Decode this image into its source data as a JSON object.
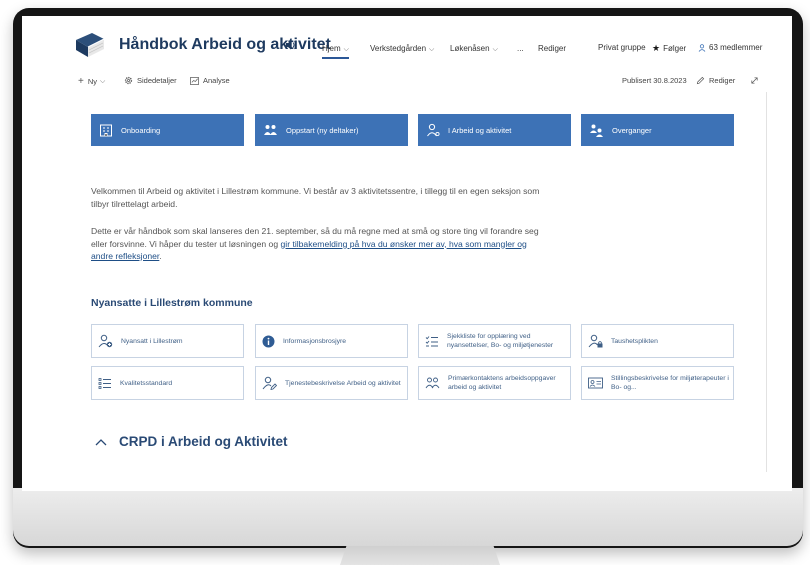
{
  "site": {
    "title": "Håndbok Arbeid og aktivitet"
  },
  "nav": {
    "items": [
      {
        "label": "Hjem",
        "dropdown": true
      },
      {
        "label": "Verkstedgården",
        "dropdown": true
      },
      {
        "label": "Løkenåsen",
        "dropdown": true
      },
      {
        "label": "..."
      },
      {
        "label": "Rediger"
      }
    ]
  },
  "header_right": {
    "group_type": "Privat gruppe",
    "follow": "Følger",
    "members": "63 medlemmer"
  },
  "commandbar": {
    "new": "Ny",
    "page_details": "Sidedetaljer",
    "analytics": "Analyse",
    "published": "Publisert 30.8.2023",
    "edit": "Rediger"
  },
  "quicklinks": [
    {
      "label": "Onboarding",
      "icon": "building-icon"
    },
    {
      "label": "Oppstart (ny deltaker)",
      "icon": "people-icon"
    },
    {
      "label": "I Arbeid og aktivitet",
      "icon": "person-icon"
    },
    {
      "label": "Overganger",
      "icon": "people-swap-icon"
    }
  ],
  "intro": {
    "p1": "Velkommen til Arbeid og aktivitet i Lillestrøm kommune. Vi består av 3 aktivitetssentre, i tillegg til en egen seksjon som tilbyr tilrettelagt arbeid.",
    "p2_start": "Dette er vår håndbok som skal lanseres den 21. september, så du må regne med at små og store ting vil forandre seg eller forsvinne. Vi håper du tester ut løsningen og ",
    "p2_link": "gir tilbakemelding på hva du ønsker mer av, hva som mangler og andre refleksjoner",
    "p2_end": "."
  },
  "section": {
    "title": "Nyansatte i Lillestrøm kommune"
  },
  "tiles": [
    {
      "label": "Nyansatt i Lillestrøm",
      "icon": "person-add-icon"
    },
    {
      "label": "Informasjonsbrosjyre",
      "icon": "info-icon"
    },
    {
      "label": "Sjekkliste for opplæring ved nyansettelser, Bo- og miljøtjenester",
      "icon": "checklist-icon"
    },
    {
      "label": "Taushetsplikten",
      "icon": "person-lock-icon"
    },
    {
      "label": "Kvalitetsstandard",
      "icon": "list-icon"
    },
    {
      "label": "Tjenestebeskrivelse Arbeid og aktivitet",
      "icon": "person-edit-icon"
    },
    {
      "label": "Primærkontaktens arbeidsoppgaver arbeid og aktivitet",
      "icon": "people-icon"
    },
    {
      "label": "Stillingsbeskrivelse for miljøterapeuter i Bo- og...",
      "icon": "contact-card-icon"
    }
  ],
  "crpd": {
    "title": "CRPD i Arbeid og Aktivitet"
  },
  "colors": {
    "accent": "#3d72b6",
    "title": "#1e3a5f",
    "section": "#2a4a75"
  }
}
